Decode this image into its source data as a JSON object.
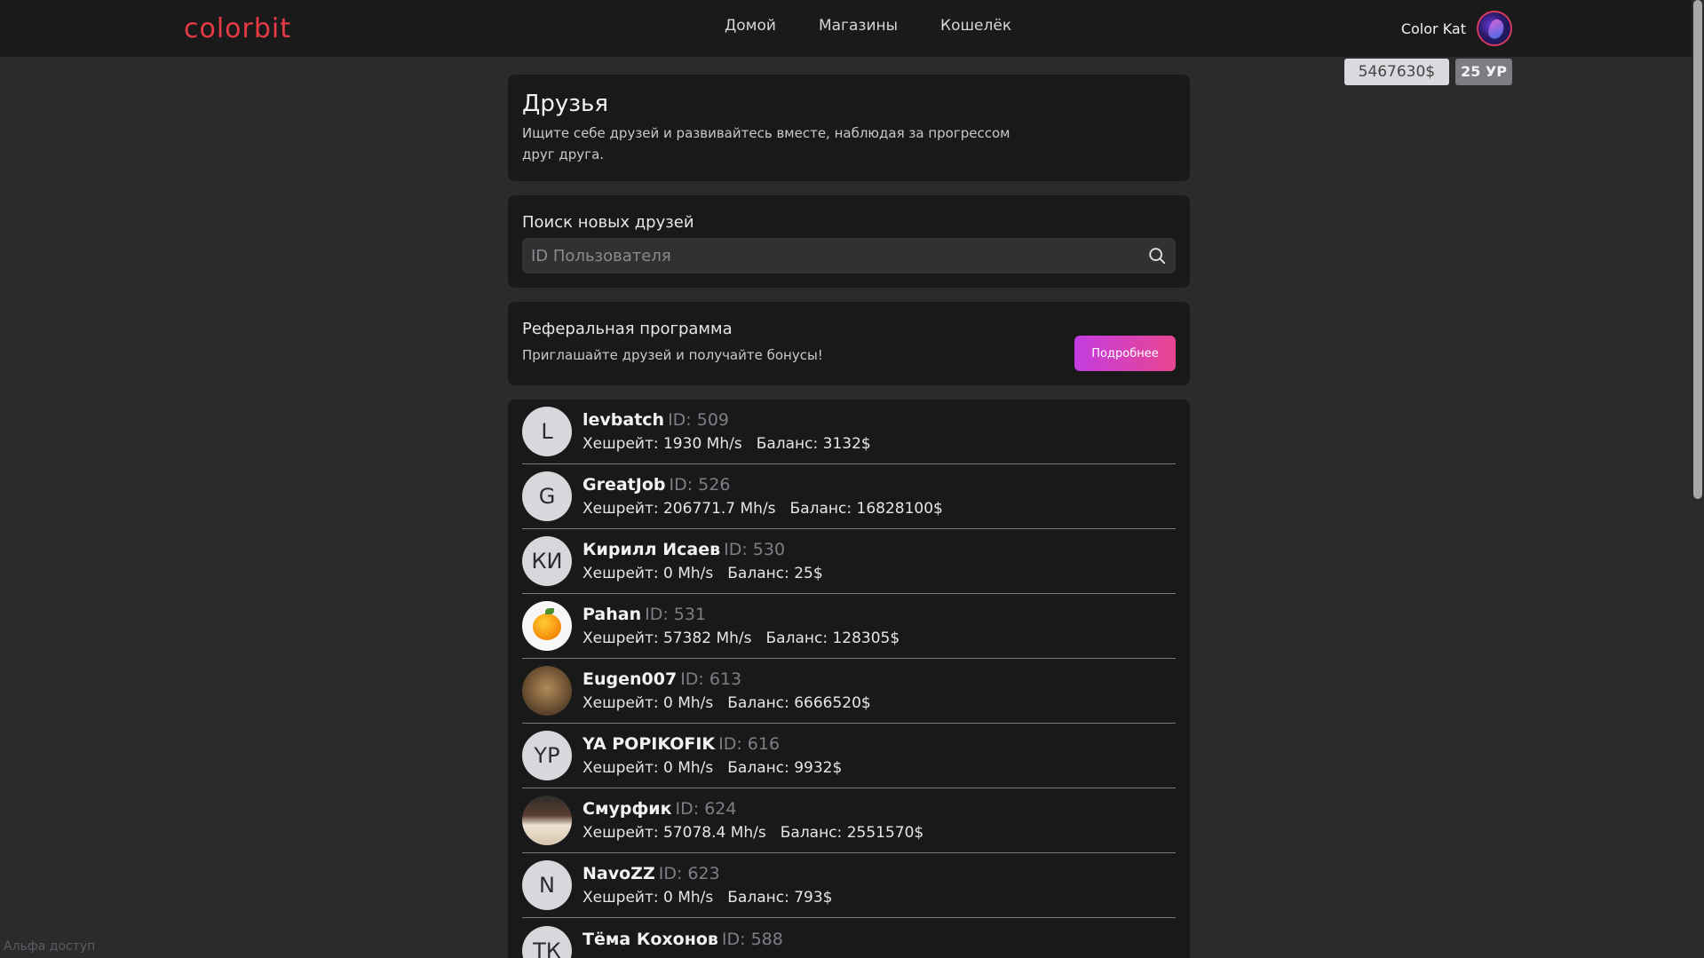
{
  "logo": {
    "text": "colorbit",
    "color": "#e63a45"
  },
  "nav": [
    {
      "label": "Домой"
    },
    {
      "label": "Магазины"
    },
    {
      "label": "Кошелёк"
    }
  ],
  "user": {
    "name": "Color Kat",
    "balance": "5467630$",
    "level": "25 УР"
  },
  "friends_card": {
    "title": "Друзья",
    "description": "Ищите себе друзей и развивайтесь вместе, наблюдая за прогрессом друг друга."
  },
  "search_card": {
    "label": "Поиск новых друзей",
    "placeholder": "ID Пользователя",
    "icon": "search-icon"
  },
  "referral_card": {
    "title": "Реферальная программа",
    "subtitle": "Приглашайте друзей и получайте бонусы!",
    "button": "Подробнее",
    "button_gradient": [
      "#c43ce0",
      "#e8468f"
    ]
  },
  "friends": [
    {
      "initials": "L",
      "name": "levbatch",
      "id": "ID: 509",
      "hashrate": "Хешрейт: 1930 Mh/s",
      "balance": "Баланс: 3132$"
    },
    {
      "initials": "G",
      "name": "GreatJob",
      "id": "ID: 526",
      "hashrate": "Хешрейт: 206771.7 Mh/s",
      "balance": "Баланс: 16828100$"
    },
    {
      "initials": "КИ",
      "name": "Кирилл Исаев",
      "id": "ID: 530",
      "hashrate": "Хешрейт: 0 Mh/s",
      "balance": "Баланс: 25$"
    },
    {
      "initials": "",
      "name": "Pahan",
      "id": "ID: 531",
      "hashrate": "Хешрейт: 57382 Mh/s",
      "balance": "Баланс: 128305$"
    },
    {
      "initials": "",
      "name": "Eugen007",
      "id": "ID: 613",
      "hashrate": "Хешрейт: 0 Mh/s",
      "balance": "Баланс: 6666520$"
    },
    {
      "initials": "YP",
      "name": "YA POPIKOFIK",
      "id": "ID: 616",
      "hashrate": "Хешрейт: 0 Mh/s",
      "balance": "Баланс: 9932$"
    },
    {
      "initials": "",
      "name": "Смурфик",
      "id": "ID: 624",
      "hashrate": "Хешрейт: 57078.4 Mh/s",
      "balance": "Баланс: 2551570$"
    },
    {
      "initials": "N",
      "name": "NavoZZ",
      "id": "ID: 623",
      "hashrate": "Хешрейт: 0 Mh/s",
      "balance": "Баланс: 793$"
    },
    {
      "initials": "ТК",
      "name": "Тёма Кохонов",
      "id": "ID: 588",
      "hashrate": "",
      "balance": ""
    }
  ],
  "footer": {
    "alpha": "Альфа доступ"
  }
}
